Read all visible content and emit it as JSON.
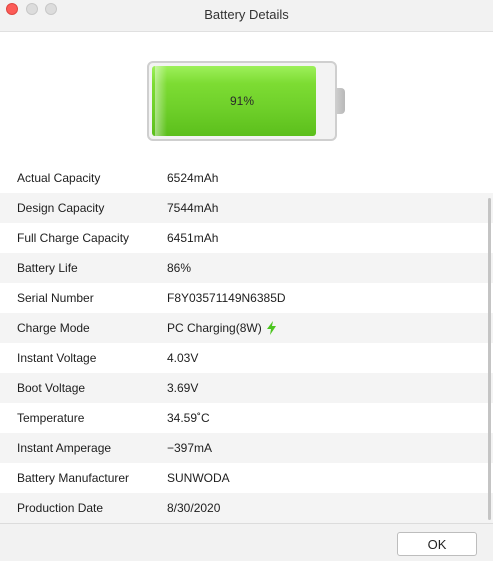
{
  "window": {
    "title": "Battery Details"
  },
  "battery": {
    "percent_label": "91%",
    "level": 0.91,
    "fill_color": "#6fd02a"
  },
  "details": [
    {
      "label": "Actual Capacity",
      "value": "6524mAh"
    },
    {
      "label": "Design Capacity",
      "value": "7544mAh"
    },
    {
      "label": "Full Charge Capacity",
      "value": "6451mAh"
    },
    {
      "label": "Battery Life",
      "value": "86%"
    },
    {
      "label": "Serial Number",
      "value": "F8Y03571149N6385D"
    },
    {
      "label": "Charge Mode",
      "value": "PC Charging(8W)",
      "icon": "charging-bolt-icon"
    },
    {
      "label": "Instant Voltage",
      "value": "4.03V"
    },
    {
      "label": "Boot Voltage",
      "value": "3.69V"
    },
    {
      "label": "Temperature",
      "value": "34.59˚C"
    },
    {
      "label": "Instant Amperage",
      "value": "−397mA"
    },
    {
      "label": "Battery Manufacturer",
      "value": "SUNWODA"
    },
    {
      "label": "Production Date",
      "value": "8/30/2020"
    }
  ],
  "footer": {
    "ok_label": "OK"
  },
  "colors": {
    "accent_green": "#4cc51f",
    "close_red": "#fc5b57"
  }
}
